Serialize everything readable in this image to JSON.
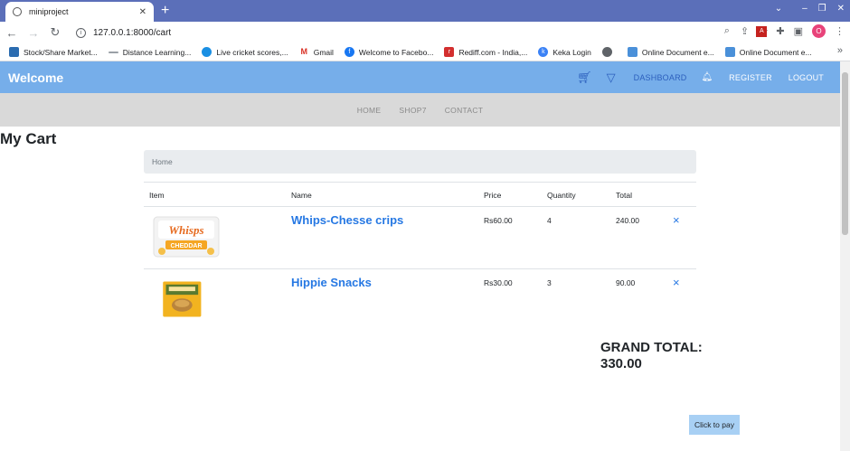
{
  "browser": {
    "tab_title": "miniproject",
    "url": "127.0.0.1:8000/cart",
    "profile_initial": "O",
    "bookmarks": [
      {
        "label": "Stock/Share Market...",
        "color": "#2b6cb0"
      },
      {
        "label": "Distance Learning...",
        "color": "#9aa0a6"
      },
      {
        "label": "Live cricket scores,...",
        "color": "#1a8fe3"
      },
      {
        "label": "Gmail",
        "color": "#d93025"
      },
      {
        "label": "Welcome to Facebo...",
        "color": "#1877f2"
      },
      {
        "label": "Rediff.com - India,...",
        "color": "#d32f2f"
      },
      {
        "label": "Keka Login",
        "color": "#3b82f6"
      },
      {
        "label": "",
        "color": "#5f6368"
      },
      {
        "label": "Online Document e...",
        "color": "#4a90d9"
      },
      {
        "label": "Online Document e...",
        "color": "#4a90d9"
      }
    ]
  },
  "app": {
    "brand": "Welcome",
    "nav_links": {
      "dashboard": "DASHBOARD",
      "register": "REGISTER",
      "logout": "LOGOUT"
    },
    "subnav": {
      "home": "HOME",
      "shop": "SHOP7",
      "contact": "CONTACT"
    },
    "accent_color": "#76aeea"
  },
  "cart": {
    "title": "My Cart",
    "breadcrumb": "Home",
    "headers": {
      "item": "Item",
      "name": "Name",
      "price": "Price",
      "quantity": "Quantity",
      "total": "Total"
    },
    "items": [
      {
        "name": "Whips-Chesse crips",
        "price": "Rs60.00",
        "quantity": "4",
        "total": "240.00",
        "remove": "×",
        "image_label": "Whisps",
        "image_sub": "CHEDDAR"
      },
      {
        "name": "Hippie Snacks",
        "price": "Rs30.00",
        "quantity": "3",
        "total": "90.00",
        "remove": "×",
        "image_label": "",
        "image_sub": ""
      }
    ],
    "grand_total_label": "GRAND TOTAL:",
    "grand_total_value": "330.00",
    "pay_button": "Click to pay"
  }
}
